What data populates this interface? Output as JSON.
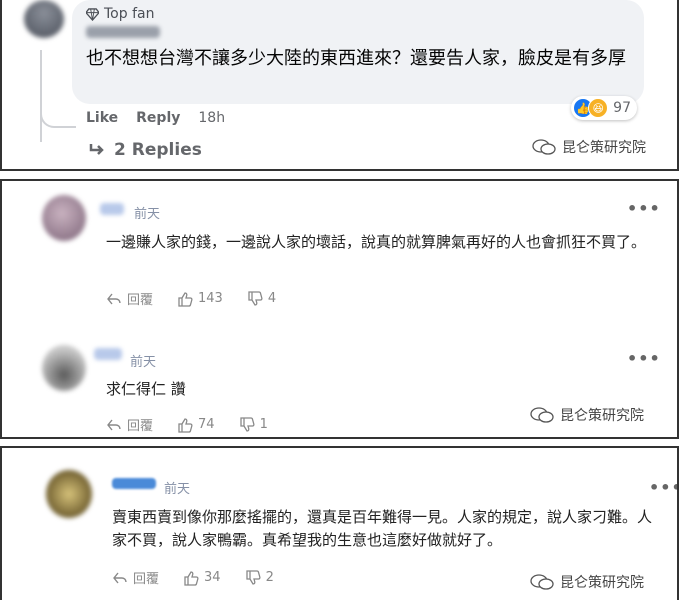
{
  "top_comment": {
    "badge": "Top fan",
    "text": "也不想想台灣不讓多少大陸的東西進來？還要告人家，臉皮是有多厚",
    "reaction_count": "97",
    "actions": {
      "like": "Like",
      "reply": "Reply",
      "time": "18h"
    },
    "replies_label": "2 Replies"
  },
  "watermark": "昆仑策研究院",
  "comments": [
    {
      "time": "前天",
      "text": "一邊賺人家的錢，一邊說人家的壞話，說真的就算脾氣再好的人也會抓狂不買了。",
      "reply_label": "回覆",
      "likes": "143",
      "dislikes": "4"
    },
    {
      "time": "前天",
      "text": "求仁得仁 讚",
      "reply_label": "回覆",
      "likes": "74",
      "dislikes": "1"
    },
    {
      "time": "前天",
      "text": "賣東西賣到像你那麼搖擺的，還真是百年難得一見。人家的規定，說人家刁難。人家不買，說人家鴨霸。真希望我的生意也這麼好做就好了。",
      "reply_label": "回覆",
      "likes": "34",
      "dislikes": "2"
    }
  ],
  "more_glyph": "•••"
}
